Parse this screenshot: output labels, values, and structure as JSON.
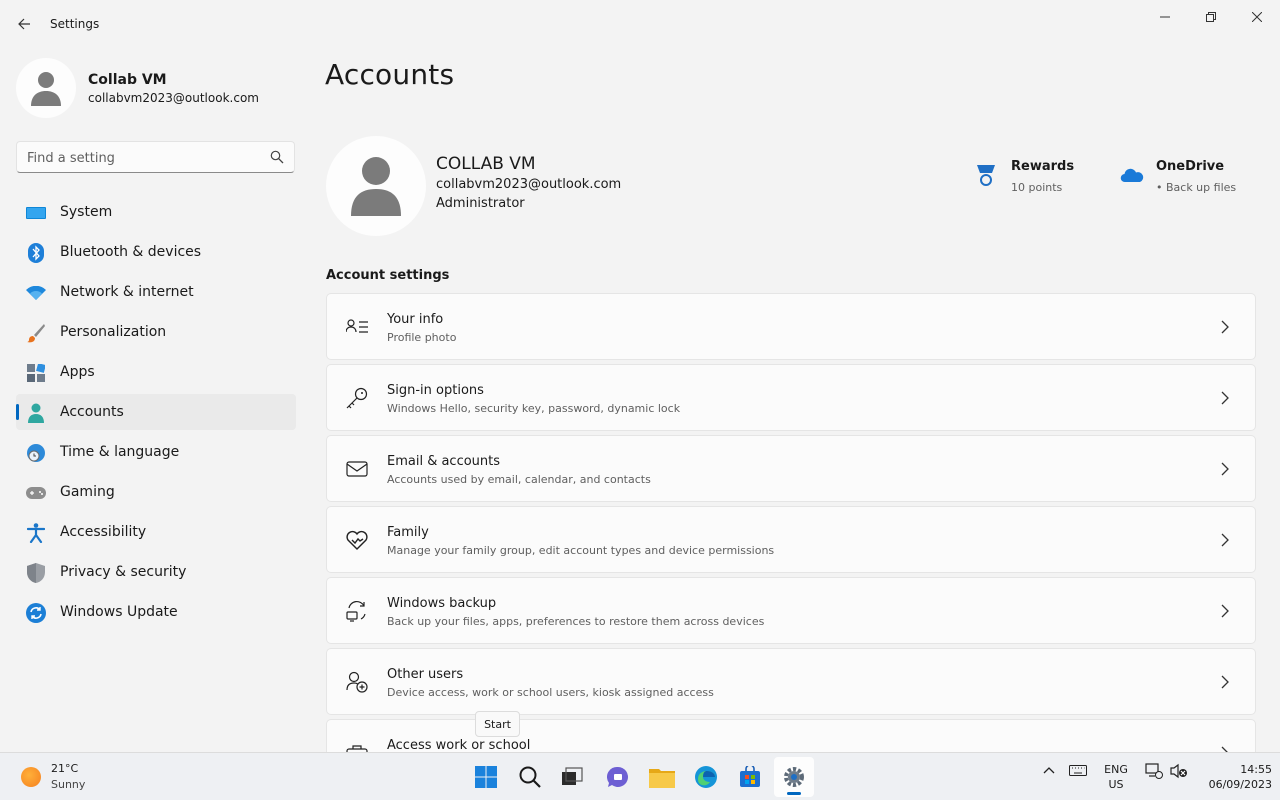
{
  "window": {
    "title": "Settings"
  },
  "user": {
    "name": "Collab VM",
    "email": "collabvm2023@outlook.com"
  },
  "search": {
    "placeholder": "Find a setting"
  },
  "nav": [
    {
      "label": "System",
      "icon": "monitor-icon"
    },
    {
      "label": "Bluetooth & devices",
      "icon": "bluetooth-icon"
    },
    {
      "label": "Network & internet",
      "icon": "wifi-icon"
    },
    {
      "label": "Personalization",
      "icon": "brush-icon"
    },
    {
      "label": "Apps",
      "icon": "apps-icon"
    },
    {
      "label": "Accounts",
      "icon": "person-icon",
      "active": true
    },
    {
      "label": "Time & language",
      "icon": "globe-clock-icon"
    },
    {
      "label": "Gaming",
      "icon": "controller-icon"
    },
    {
      "label": "Accessibility",
      "icon": "accessibility-icon"
    },
    {
      "label": "Privacy & security",
      "icon": "shield-icon"
    },
    {
      "label": "Windows Update",
      "icon": "update-icon"
    }
  ],
  "page": {
    "title": "Accounts"
  },
  "profile": {
    "name": "COLLAB VM",
    "email": "collabvm2023@outlook.com",
    "role": "Administrator"
  },
  "services": {
    "rewards": {
      "title": "Rewards",
      "subtitle": "10 points"
    },
    "onedrive": {
      "title": "OneDrive",
      "subtitle": "• Back up files"
    }
  },
  "account_settings": {
    "heading": "Account settings",
    "items": [
      {
        "title": "Your info",
        "subtitle": "Profile photo",
        "icon": "contact-card-icon"
      },
      {
        "title": "Sign-in options",
        "subtitle": "Windows Hello, security key, password, dynamic lock",
        "icon": "key-icon"
      },
      {
        "title": "Email & accounts",
        "subtitle": "Accounts used by email, calendar, and contacts",
        "icon": "mail-icon"
      },
      {
        "title": "Family",
        "subtitle": "Manage your family group, edit account types and device permissions",
        "icon": "heart-icon"
      },
      {
        "title": "Windows backup",
        "subtitle": "Back up your files, apps, preferences to restore them across devices",
        "icon": "backup-icon"
      },
      {
        "title": "Other users",
        "subtitle": "Device access, work or school users, kiosk assigned access",
        "icon": "add-person-icon"
      },
      {
        "title": "Access work or school",
        "subtitle": "",
        "icon": "briefcase-icon"
      }
    ]
  },
  "tooltip": {
    "text": "Start"
  },
  "taskbar": {
    "weather": {
      "temp": "21°C",
      "condition": "Sunny"
    },
    "language": {
      "line1": "ENG",
      "line2": "US"
    },
    "clock": {
      "time": "14:55",
      "date": "06/09/2023"
    }
  },
  "colors": {
    "accent": "#0067c0",
    "background": "#f3f3f3",
    "card": "#fbfbfb"
  }
}
